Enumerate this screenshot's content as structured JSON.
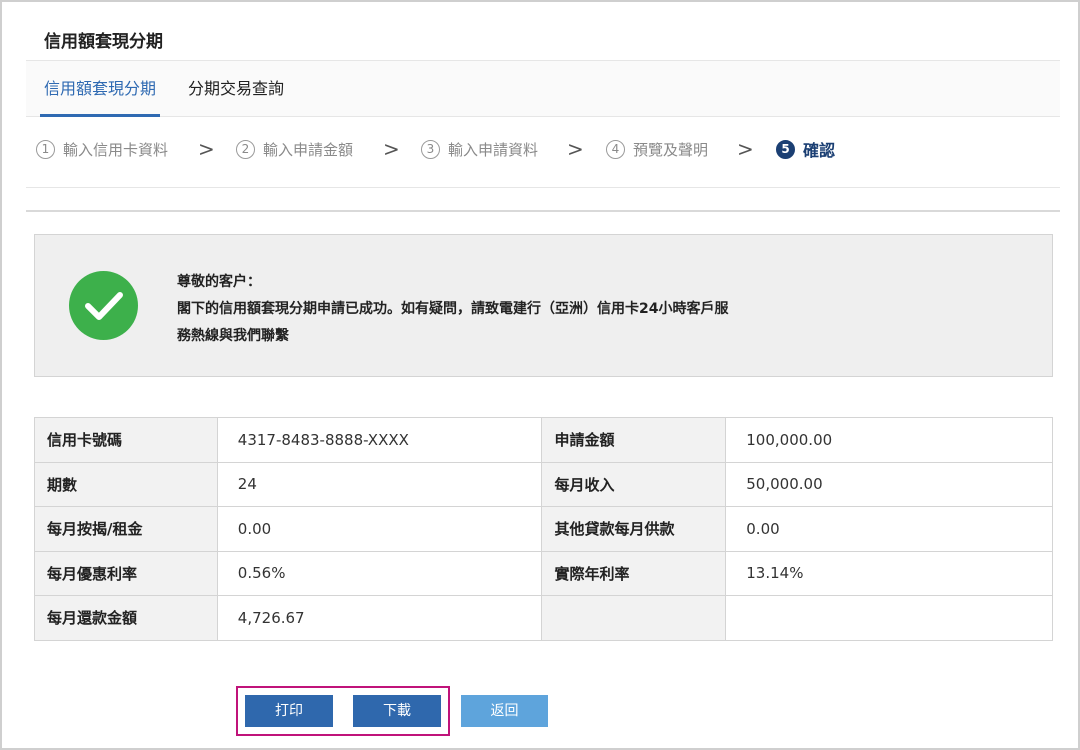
{
  "page": {
    "title": "信用額套現分期"
  },
  "tabs": [
    {
      "label": "信用額套現分期",
      "active": true
    },
    {
      "label": "分期交易查詢",
      "active": false
    }
  ],
  "steps": [
    {
      "num": "1",
      "label": "輸入信用卡資料"
    },
    {
      "num": "2",
      "label": "輸入申請金額"
    },
    {
      "num": "3",
      "label": "輸入申請資料"
    },
    {
      "num": "4",
      "label": "預覽及聲明"
    },
    {
      "num": "5",
      "label": "確認"
    }
  ],
  "chevron": ">",
  "notice": {
    "icon": "check-circle-icon",
    "line1": "尊敬的客户：",
    "line2": "閣下的信用額套現分期申請已成功。如有疑問，請致電建行（亞洲）信用卡24小時客戶服",
    "line3": "務熱線與我們聯繫"
  },
  "details": {
    "rows": [
      {
        "l1": "信用卡號碼",
        "v1": "4317-8483-8888-XXXX",
        "l2": "申請金額",
        "v2": "100,000.00"
      },
      {
        "l1": "期數",
        "v1": "24",
        "l2": "每月收入",
        "v2": "50,000.00"
      },
      {
        "l1": "每月按揭/租金",
        "v1": "0.00",
        "l2": "其他貸款每月供款",
        "v2": "0.00"
      },
      {
        "l1": "每月優惠利率",
        "v1": "0.56%",
        "l2": "實際年利率",
        "v2": "13.14%"
      },
      {
        "l1": "每月還款金額",
        "v1": "4,726.67",
        "l2": "",
        "v2": ""
      }
    ]
  },
  "buttons": {
    "print": "打印",
    "download": "下載",
    "back": "返回"
  },
  "colors": {
    "primary": "#2f68ad",
    "secondary": "#5ea4dc",
    "success": "#3db04b",
    "highlight": "#c0137a",
    "active_step": "#1b3f73"
  }
}
